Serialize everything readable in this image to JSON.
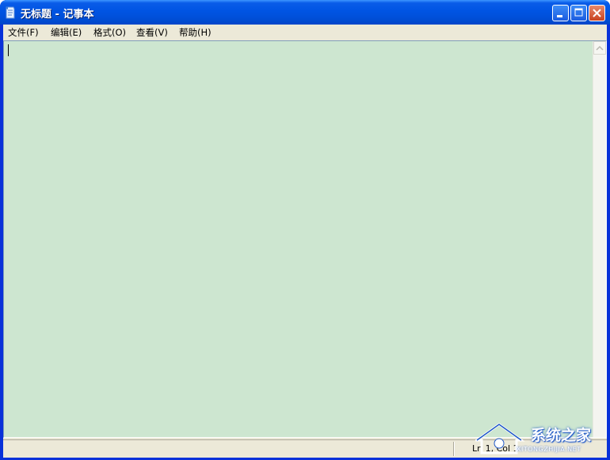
{
  "window": {
    "title": "无标题 - 记事本",
    "controls": {
      "minimize": "minimize-icon",
      "maximize": "maximize-icon",
      "close": "close-icon"
    }
  },
  "menubar": {
    "items": [
      {
        "label": "文件(F)"
      },
      {
        "label": "编辑(E)"
      },
      {
        "label": "格式(O)"
      },
      {
        "label": "查看(V)"
      },
      {
        "label": "帮助(H)"
      }
    ]
  },
  "editor": {
    "content": "",
    "background": "#cde6d0"
  },
  "statusbar": {
    "position": "Ln 1, Col 1"
  },
  "watermark": {
    "text": "系统之家",
    "url": "XITONGZHIJIA.NET"
  },
  "colors": {
    "titlebar": "#0054e3",
    "close_button": "#c8421f",
    "menubar": "#ece9d8"
  }
}
